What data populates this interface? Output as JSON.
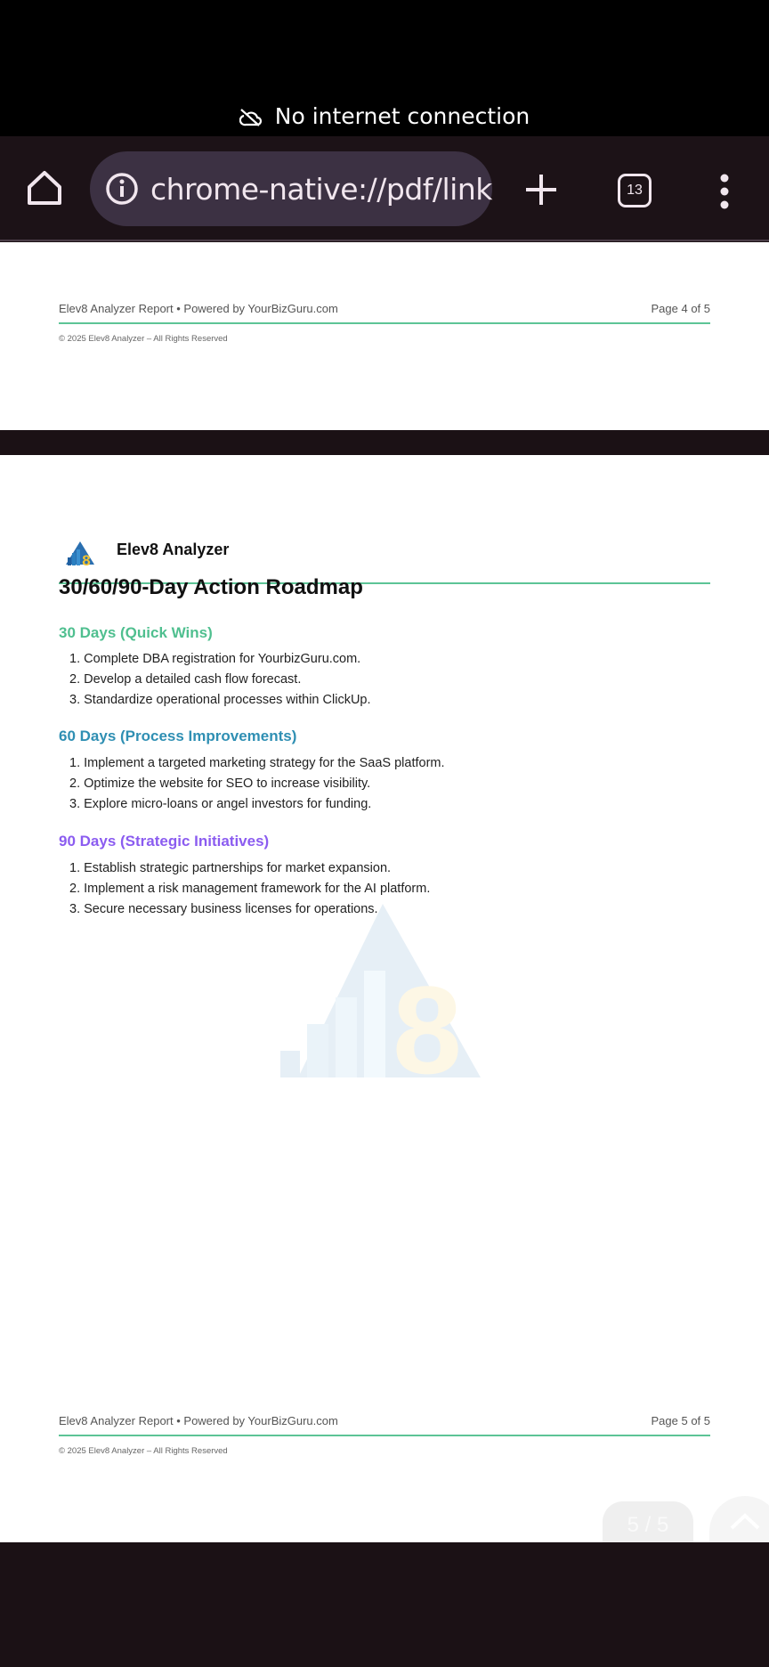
{
  "status_bar": {
    "message": "No internet connection",
    "icon": "cloud-off-icon"
  },
  "toolbar": {
    "url": "chrome-native://pdf/link",
    "tab_count": "13"
  },
  "pdf": {
    "page4_footer": {
      "left": "Elev8 Analyzer Report • Powered by YourBizGuru.com",
      "right": "Page 4 of 5",
      "copyright": "© 2025 Elev8 Analyzer – All Rights Reserved"
    },
    "page5": {
      "brand": "Elev8 Analyzer",
      "title": "30/60/90-Day Action Roadmap",
      "sections": [
        {
          "heading": "30 Days (Quick Wins)",
          "color": "#4fbf8f",
          "items": [
            "1. Complete DBA registration for YourbizGuru.com.",
            "2. Develop a detailed cash flow forecast.",
            "3. Standardize operational processes within ClickUp."
          ]
        },
        {
          "heading": "60 Days (Process Improvements)",
          "color": "#2f8fb3",
          "items": [
            "1. Implement a targeted marketing strategy for the SaaS platform.",
            "2. Optimize the website for SEO to increase visibility.",
            "3. Explore micro-loans or angel investors for funding."
          ]
        },
        {
          "heading": "90 Days (Strategic Initiatives)",
          "color": "#8b5cf0",
          "items": [
            "1. Establish strategic partnerships for market expansion.",
            "2. Implement a risk management framework for the AI platform.",
            "3. Secure necessary business licenses for operations."
          ]
        }
      ],
      "footer": {
        "left": "Elev8 Analyzer Report • Powered by YourBizGuru.com",
        "right": "Page 5 of 5",
        "copyright": "© 2025 Elev8 Analyzer – All Rights Reserved"
      }
    },
    "page_indicator": "5 / 5"
  }
}
